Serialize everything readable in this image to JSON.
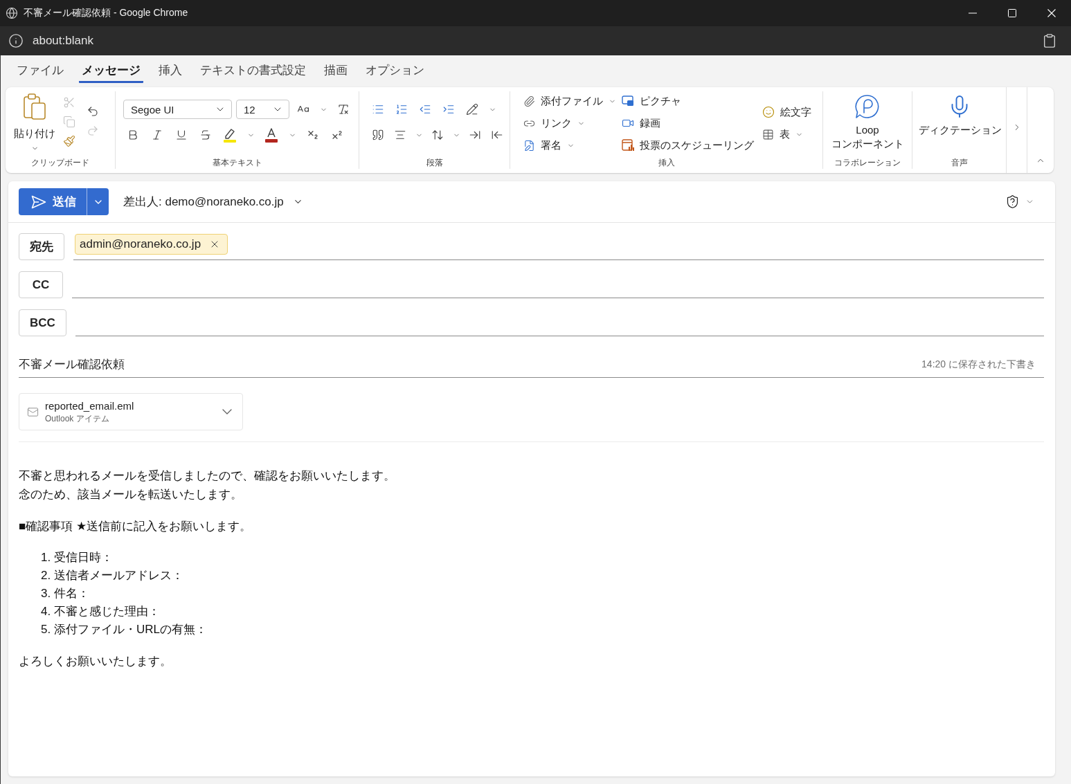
{
  "window": {
    "title": "不審メール確認依頼 - Google Chrome"
  },
  "address_bar": {
    "url": "about:blank"
  },
  "tabs": [
    {
      "label": "ファイル",
      "selected": false
    },
    {
      "label": "メッセージ",
      "selected": true
    },
    {
      "label": "挿入",
      "selected": false
    },
    {
      "label": "テキストの書式設定",
      "selected": false
    },
    {
      "label": "描画",
      "selected": false
    },
    {
      "label": "オプション",
      "selected": false
    }
  ],
  "ribbon": {
    "clipboard": {
      "label": "クリップボード",
      "paste": {
        "label": "貼り付け"
      },
      "cut": {
        "disabled": true
      },
      "copy": {
        "disabled": true
      },
      "format_painter": {
        "disabled": false
      },
      "undo": {
        "disabled": false
      },
      "redo": {
        "disabled": true
      }
    },
    "basic_text": {
      "label": "基本テキスト",
      "font": {
        "value": "Segoe UI"
      },
      "size": {
        "value": "12"
      }
    },
    "paragraph": {
      "label": "段落"
    },
    "insert": {
      "label": "挿入",
      "columns": [
        {
          "items": [
            {
              "kind": "attach",
              "label": "添付ファイル",
              "dropdown": true
            },
            {
              "kind": "link",
              "label": "リンク",
              "dropdown": true
            },
            {
              "kind": "signature",
              "label": "署名",
              "dropdown": true
            }
          ]
        },
        {
          "items": [
            {
              "kind": "picture",
              "label": "ピクチャ",
              "dropdown": false
            },
            {
              "kind": "recording",
              "label": "録画",
              "dropdown": false
            },
            {
              "kind": "poll",
              "label": "投票のスケジューリング",
              "dropdown": false
            }
          ]
        },
        {
          "items": [
            {
              "kind": "emoji",
              "label": "絵文字",
              "dropdown": false
            },
            {
              "kind": "table",
              "label": "表",
              "dropdown": true
            }
          ]
        }
      ]
    },
    "collaboration": {
      "label": "コラボレーション",
      "button": {
        "label": "Loop コンポーネント"
      }
    },
    "voice": {
      "label": "音声",
      "button": {
        "label": "ディクテーション"
      }
    }
  },
  "compose": {
    "send": {
      "label": "送信"
    },
    "from": "差出人: demo@noraneko.co.jp",
    "recipients": [
      {
        "label": "宛先",
        "chips": [
          {
            "address": "admin@noraneko.co.jp"
          }
        ]
      },
      {
        "label": "CC"
      },
      {
        "label": "BCC"
      }
    ],
    "subject": "不審メール確認依頼",
    "draft_status": "14:20 に保存された下書き",
    "attachments": [
      {
        "name": "reported_email.eml",
        "type": "Outlook アイテム"
      }
    ],
    "body": {
      "intro": [
        "不審と思われるメールを受信しましたので、確認をお願いいたします。",
        "念のため、該当メールを転送いたします。"
      ],
      "checklist_heading": "■確認事項 ★送信前に記入をお願いします。",
      "checklist": [
        "1. 受信日時：",
        "2. 送信者メールアドレス：",
        "3. 件名：",
        "4. 不審と感じた理由：",
        "5. 添付ファイル・URLの有無："
      ],
      "closing": "よろしくお願いいたします。"
    }
  }
}
